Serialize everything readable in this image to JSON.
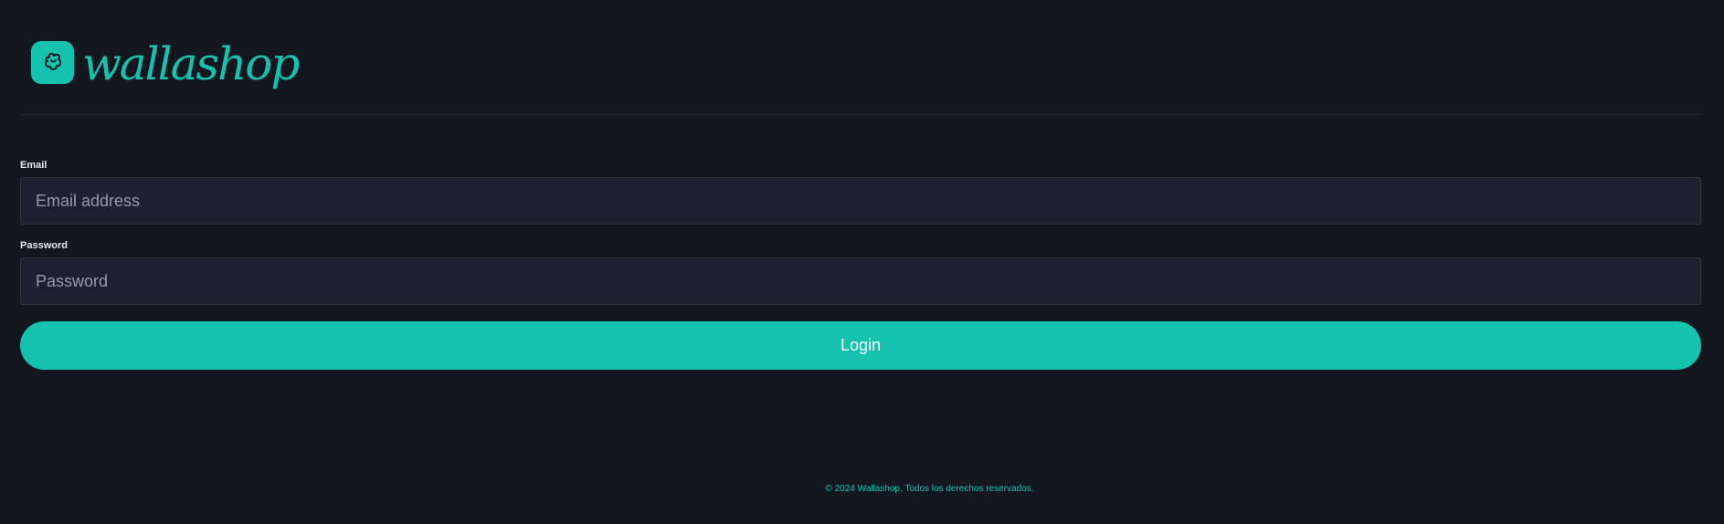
{
  "brand": {
    "name": "wallashop",
    "icon": "shopping-bag-logo-icon",
    "accent_color": "#15c2ae",
    "background_color": "#131720"
  },
  "form": {
    "email": {
      "label": "Email",
      "value": "",
      "placeholder": "Email address"
    },
    "password": {
      "label": "Password",
      "value": "",
      "placeholder": "Password"
    },
    "submit_label": "Login"
  },
  "footer": {
    "copyright": "© 2024 Wallashop. Todos los derechos reservados."
  }
}
